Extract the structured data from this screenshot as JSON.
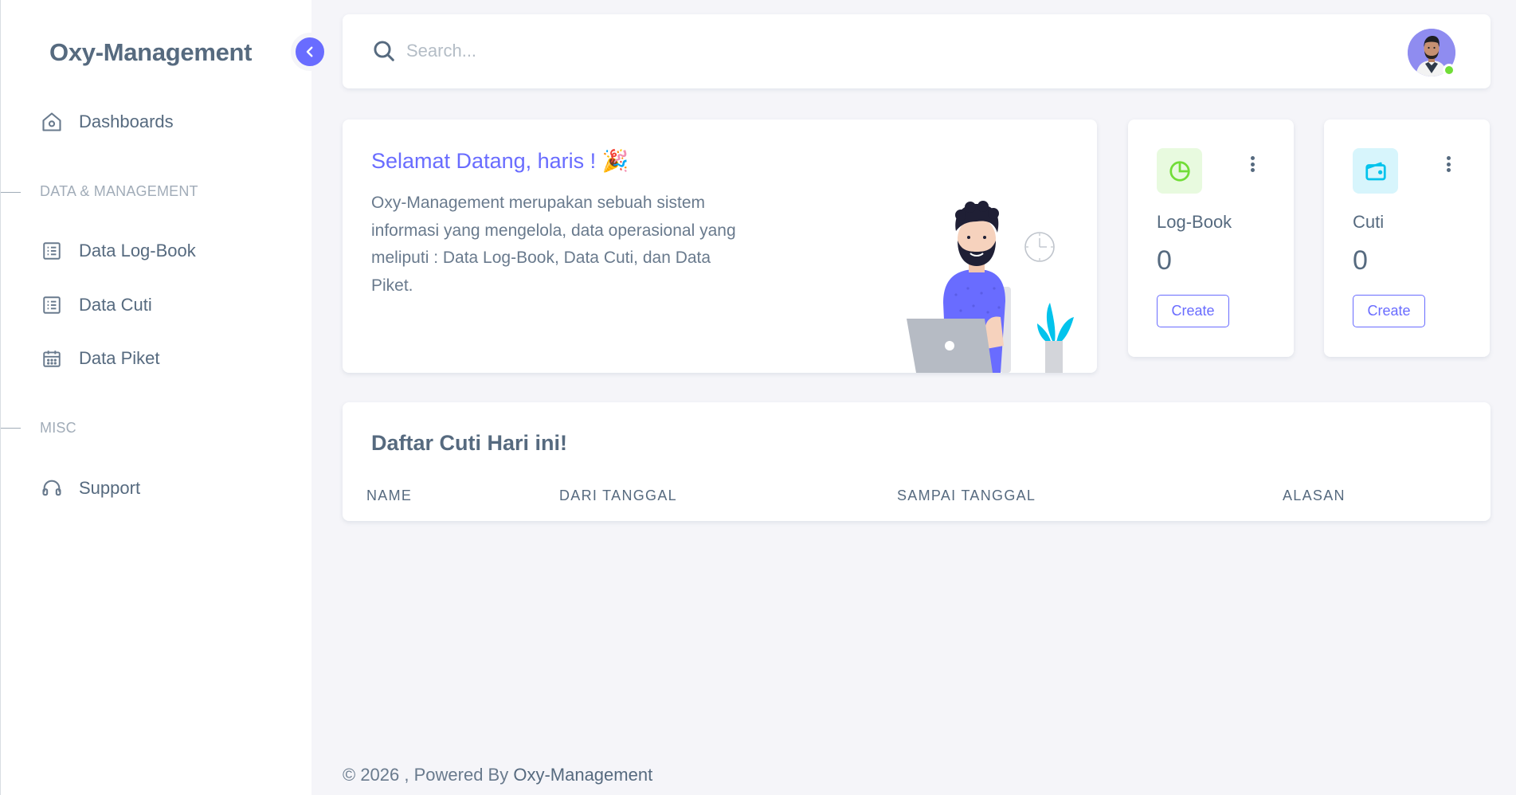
{
  "brand": {
    "name": "Oxy-Management"
  },
  "sidebar": {
    "items": [
      {
        "label": "Dashboards",
        "icon": "home-icon"
      },
      {
        "label": "Data Log-Book",
        "icon": "list-icon"
      },
      {
        "label": "Data Cuti",
        "icon": "list-icon"
      },
      {
        "label": "Data Piket",
        "icon": "calendar-icon"
      },
      {
        "label": "Support",
        "icon": "headset-icon"
      }
    ],
    "headers": [
      "DATA & MANAGEMENT",
      "MISC"
    ]
  },
  "navbar": {
    "search_placeholder": "Search...",
    "status": "online"
  },
  "welcome": {
    "title": "Selamat Datang, haris ! 🎉",
    "text": "Oxy-Management merupakan sebuah sistem informasi yang mengelola, data operasional yang meliputi : Data Log-Book, Data Cuti, dan Data Piket."
  },
  "stats": [
    {
      "label": "Log-Book",
      "value": "0",
      "button": "Create",
      "icon": "pie-chart-icon",
      "icon_color": "#71dd37",
      "icon_bg": "#e8fadf"
    },
    {
      "label": "Cuti",
      "value": "0",
      "button": "Create",
      "icon": "wallet-icon",
      "icon_color": "#03c3ec",
      "icon_bg": "#d7f5fc"
    }
  ],
  "table": {
    "title": "Daftar Cuti Hari ini!",
    "columns": [
      "NAME",
      "DARI TANGGAL",
      "SAMPAI TANGGAL",
      "ALASAN"
    ],
    "rows": []
  },
  "footer": {
    "prefix": "© 2026 , Powered By ",
    "brand": "Oxy-Management"
  },
  "colors": {
    "primary": "#696cff",
    "text": "#566a7f",
    "background": "#f5f5f9"
  }
}
